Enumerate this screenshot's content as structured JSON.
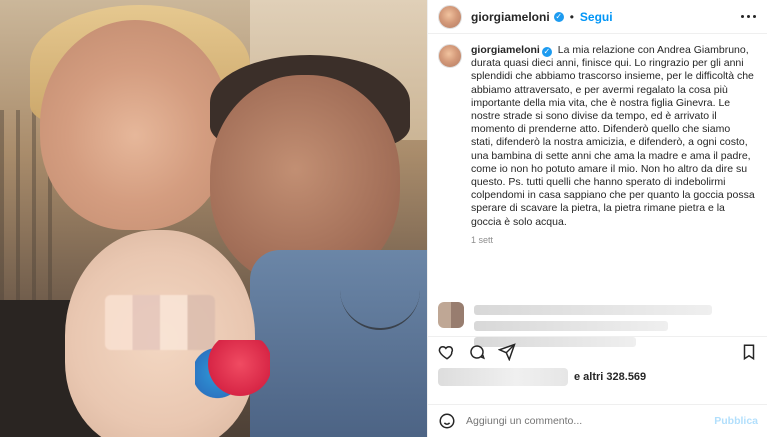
{
  "post": {
    "username": "giorgiameloni",
    "follow_label": "Segui",
    "caption": {
      "username": "giorgiameloni",
      "text": "La mia relazione con Andrea Giambruno, durata quasi dieci anni, finisce qui. Lo ringrazio per gli anni splendidi che abbiamo trascorso insieme, per le difficoltà che abbiamo attraversato, e per avermi regalato la cosa più importante della mia vita, che è nostra figlia Ginevra. Le nostre strade si sono divise da tempo, ed è arrivato il momento di prenderne atto. Difenderò quello che siamo stati, difenderò la nostra amicizia, e difenderò, a ogni costo, una bambina di sette anni che ama la madre e ama il padre, come io non ho potuto amare il mio. Non ho altro da dire su questo. Ps. tutti quelli che hanno sperato di indebolirmi colpendomi in casa sappiano che per quanto la goccia possa sperare di scavare la pietra, la pietra rimane pietra e la goccia è solo acqua.",
      "time": "1 sett"
    },
    "likes_suffix": "e altri 328.569",
    "add_comment_placeholder": "Aggiungi un commento...",
    "publish_label": "Pubblica"
  },
  "icons": {
    "more": "more-icon",
    "like": "heart-icon",
    "comment": "comment-icon",
    "share": "share-icon",
    "save": "bookmark-icon",
    "emoji": "emoji-icon",
    "verified": "verified-badge-icon"
  },
  "colors": {
    "link_blue": "#0095f6",
    "verified_blue": "#1d9bf0",
    "muted": "#8e8e8e",
    "publish_disabled": "#b2dffc"
  }
}
